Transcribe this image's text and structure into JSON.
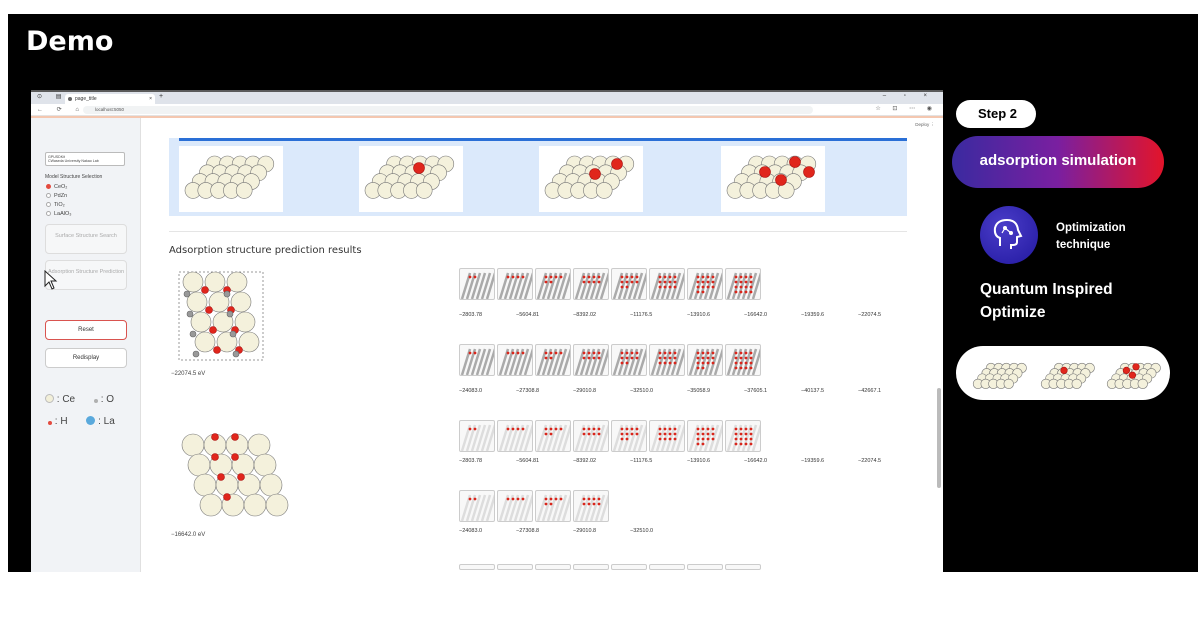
{
  "slide": {
    "title": "Demo"
  },
  "browser": {
    "tab_title": "page_title",
    "url": "localhost:5050",
    "top_right_menu": "Deploy  ⋮"
  },
  "sidebar": {
    "org_box": "GPUSDKit\nCWaseda University Nakao Lab",
    "model_selection_heading": "Model Structure Selection",
    "options": [
      "CeO₂",
      "PdZn",
      "TiO₂",
      "LaAlO₃"
    ],
    "selected_option": "CeO₂",
    "surface_search_button": "Surface Structure Search",
    "adsorption_prediction_button": "Adsorption Structure Prediction",
    "reset_button": "Reset",
    "redisplay_button": "Redisplay",
    "legend": [
      {
        "symbol": "Ce",
        "label": ": Ce",
        "color": "#f2efd9"
      },
      {
        "symbol": "O",
        "label": ": O",
        "color": "#b0b0b0"
      },
      {
        "symbol": "H",
        "label": ": H",
        "color": "#e34b3f"
      },
      {
        "symbol": "La",
        "label": ": La",
        "color": "#5aa9dc"
      }
    ]
  },
  "main": {
    "results_title": "Adsorption structure prediction results",
    "group1": {
      "energy": "−22074.5 eV",
      "row1_values": [
        "−2803.78",
        "−5604.81",
        "−8392.02",
        "−11176.5",
        "−13910.6",
        "−16642.0",
        "−19359.6",
        "−22074.5"
      ],
      "row2_values": [
        "−24083.0",
        "−27308.8",
        "−29010.8",
        "−32510.0",
        "−35058.9",
        "−37605.1",
        "−40137.5",
        "−42667.1"
      ]
    },
    "group2": {
      "energy": "−16642.0 eV",
      "row1_values": [
        "−2803.78",
        "−5604.81",
        "−8392.02",
        "−11176.5",
        "−13910.6",
        "−16642.0",
        "−19359.6",
        "−22074.5"
      ],
      "row2_values": [
        "−24083.0",
        "−27308.8",
        "−29010.8",
        "−32510.0"
      ]
    }
  },
  "right_panel": {
    "step": "Step 2",
    "simulation": "adsorption simulation",
    "optimization_line1": "Optimization",
    "optimization_line2": "technique",
    "qio_line1": "Quantum Inspired",
    "qio_line2": "Optimize"
  }
}
